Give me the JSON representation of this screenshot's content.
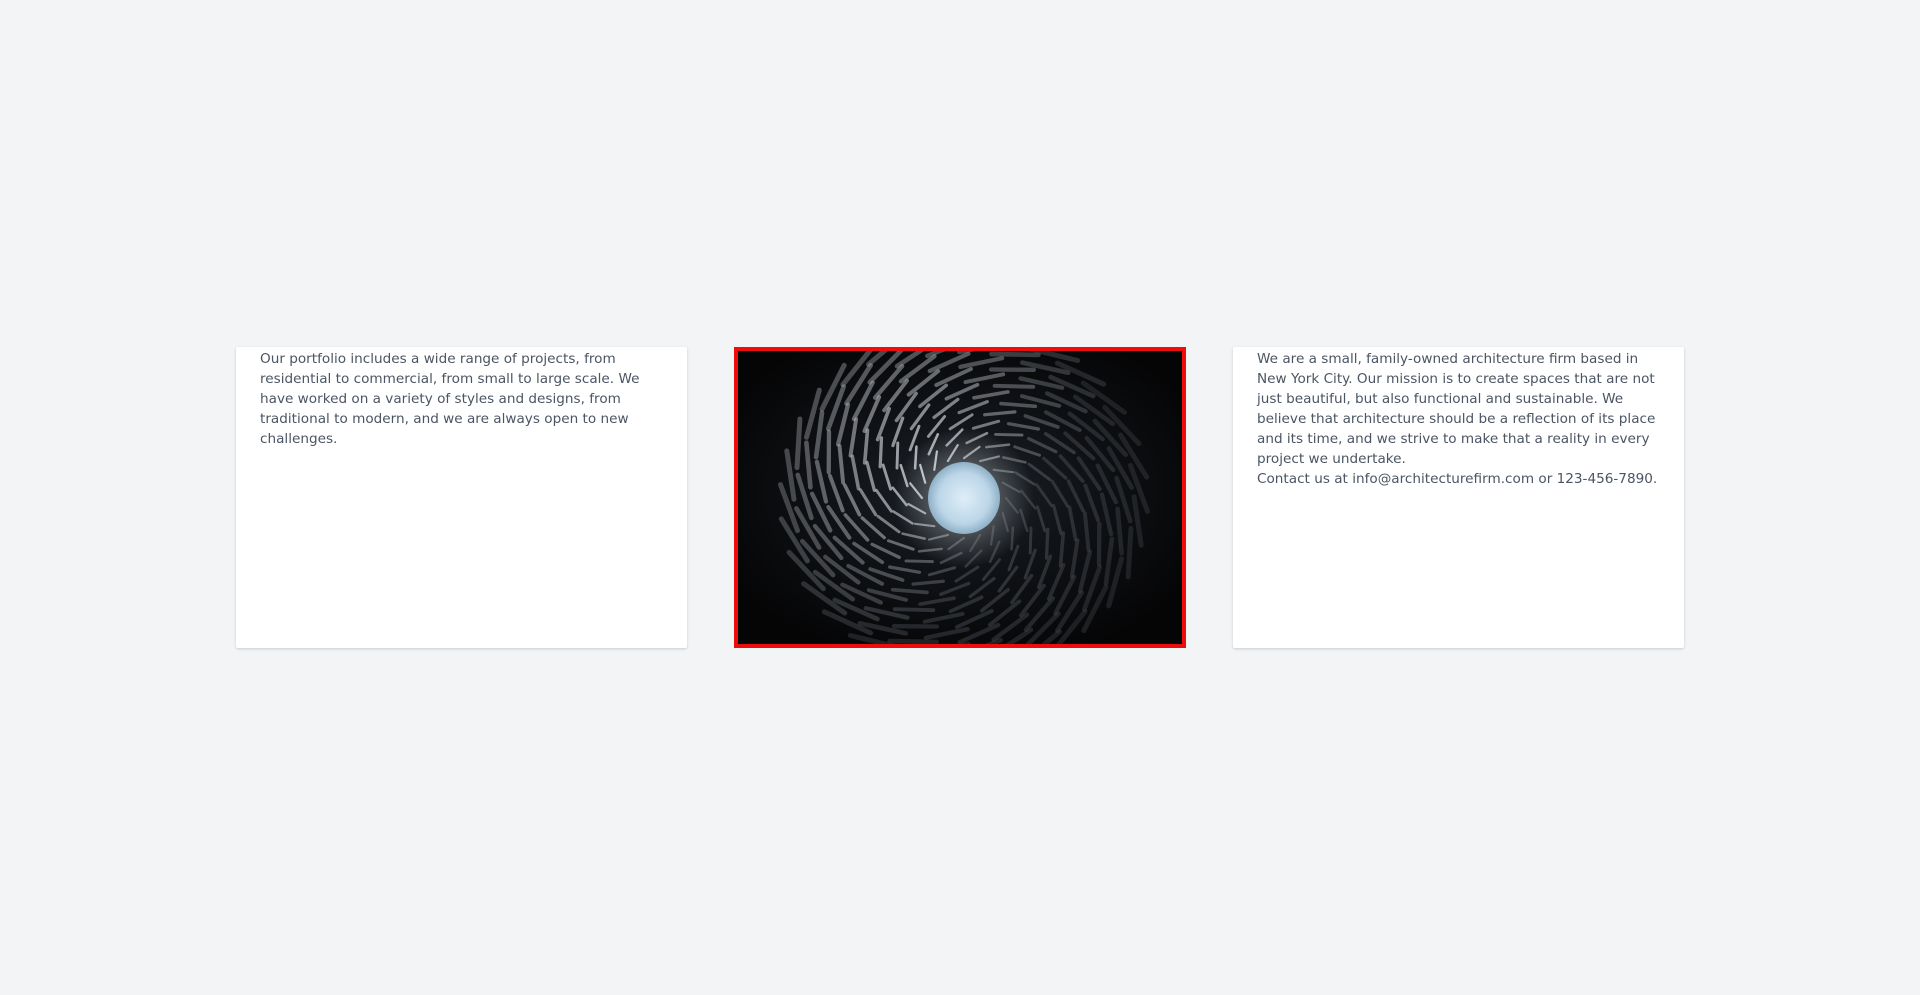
{
  "cards": {
    "portfolio": {
      "text": "Our portfolio includes a wide range of projects, from residential to commercial, from small to large scale. We have worked on a variety of styles and designs, from traditional to modern, and we are always open to new challenges."
    },
    "about": {
      "text": "We are a small, family-owned architecture firm based in New York City. Our mission is to create spaces that are not just beautiful, but also functional and sustainable. We believe that architecture should be a reflection of its place and its time, and we strive to make that a reality in every project we undertake.",
      "contact": "Contact us at info@architecturefirm.com or 123-456-7890."
    }
  },
  "image": {
    "icon": "spiral-tunnel-photo",
    "highlight_color": "#ee0d0d"
  },
  "colors": {
    "background": "#f3f4f6",
    "card": "#ffffff",
    "text": "#4b5563"
  }
}
